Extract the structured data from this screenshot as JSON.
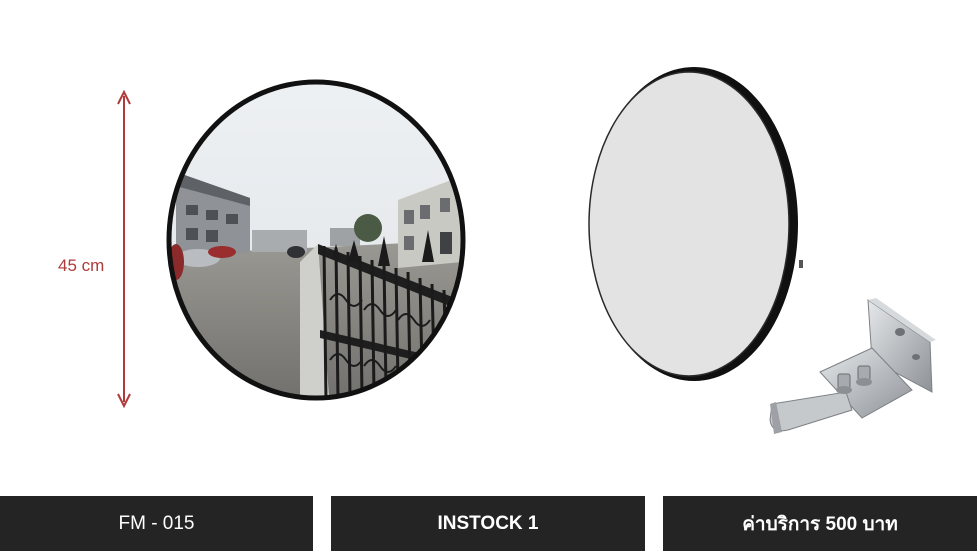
{
  "dimension": {
    "label": "45 cm",
    "arrow_color": "#b03a3a"
  },
  "product": {
    "mirror_front_image": "convex-mirror-reflection",
    "mirror_side_image": "convex-mirror-blank",
    "bracket_image": "mounting-bracket-icon"
  },
  "footer": {
    "code": "FM - 015",
    "stock": "INSTOCK 1",
    "price": "ค่าบริการ 500 บาท"
  },
  "colors": {
    "footer_bg": "#242424",
    "footer_text": "#ffffff",
    "mirror_frame": "#111111",
    "accent": "#b03a3a"
  }
}
